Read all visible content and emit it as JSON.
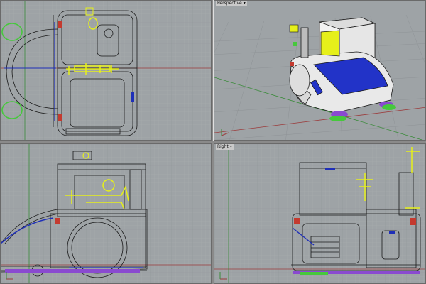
{
  "viewports": [
    {
      "id": "top",
      "label": ""
    },
    {
      "id": "perspective",
      "label": "Perspective"
    },
    {
      "id": "front",
      "label": ""
    },
    {
      "id": "right",
      "label": "Right"
    }
  ],
  "colors": {
    "grid_bg": "#9ea3a6",
    "grid_minor": "#a9adb0",
    "grid_major": "#8e9396",
    "axis_x": "#9b3b3b",
    "axis_y": "#3b8b3b",
    "wire": "#1a1a1a",
    "accent_blue": "#1f2fb8",
    "highlight_yellow": "#e6f01a",
    "green_wheel": "#46c83c",
    "purple_wheel": "#8a4ad0",
    "red_light": "#c43a2f"
  },
  "icons": {
    "dropdown": "chevron-down-icon",
    "world_axes": "axis-gizmo-icon"
  }
}
